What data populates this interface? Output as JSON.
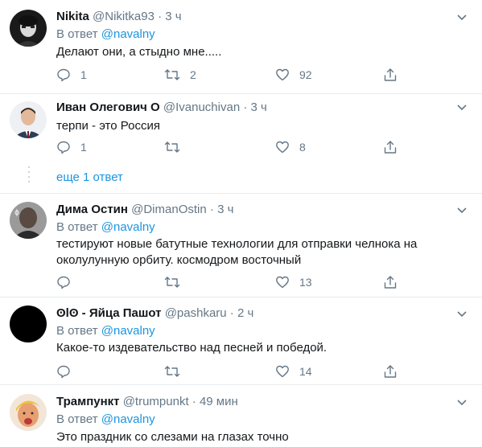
{
  "tweets": [
    {
      "name": "Nikita",
      "handle": "@Nikitka93",
      "time": "3 ч",
      "reply_prefix": "В ответ",
      "reply_to": "@navalny",
      "text": "Делают они, а стыдно мне.....",
      "replies": "1",
      "retweets": "2",
      "likes": "92"
    },
    {
      "name": "Иван Олегович О",
      "handle": "@Ivanuchivan",
      "time": "3 ч",
      "text": "терпи - это Россия",
      "replies": "1",
      "retweets": "",
      "likes": "8"
    },
    {
      "name": "Дима Остин",
      "handle": "@DimanOstin",
      "time": "3 ч",
      "reply_prefix": "В ответ",
      "reply_to": "@navalny",
      "text": "тестируют новые батутные технологии для отправки челнока на околулунную орбиту. космодром восточный",
      "replies": "",
      "retweets": "",
      "likes": "13"
    },
    {
      "name": "ʘlʘ - Яйца Пашот",
      "handle": "@pashkaru",
      "time": "2 ч",
      "reply_prefix": "В ответ",
      "reply_to": "@navalny",
      "text": "Какое-то издевательство над песней и победой.",
      "replies": "",
      "retweets": "",
      "likes": "14"
    },
    {
      "name": "Трампункт",
      "handle": "@trumpunkt",
      "time": "49 мин",
      "reply_prefix": "В ответ",
      "reply_to": "@navalny",
      "text": "Это праздник со слезами на глазах точно"
    }
  ],
  "thread": {
    "more_replies": "еще 1 ответ"
  },
  "colors": {
    "accent": "#1b95e0",
    "muted": "#657786",
    "divider": "#e6ecf0",
    "thread_line": "#ccd6dd"
  }
}
